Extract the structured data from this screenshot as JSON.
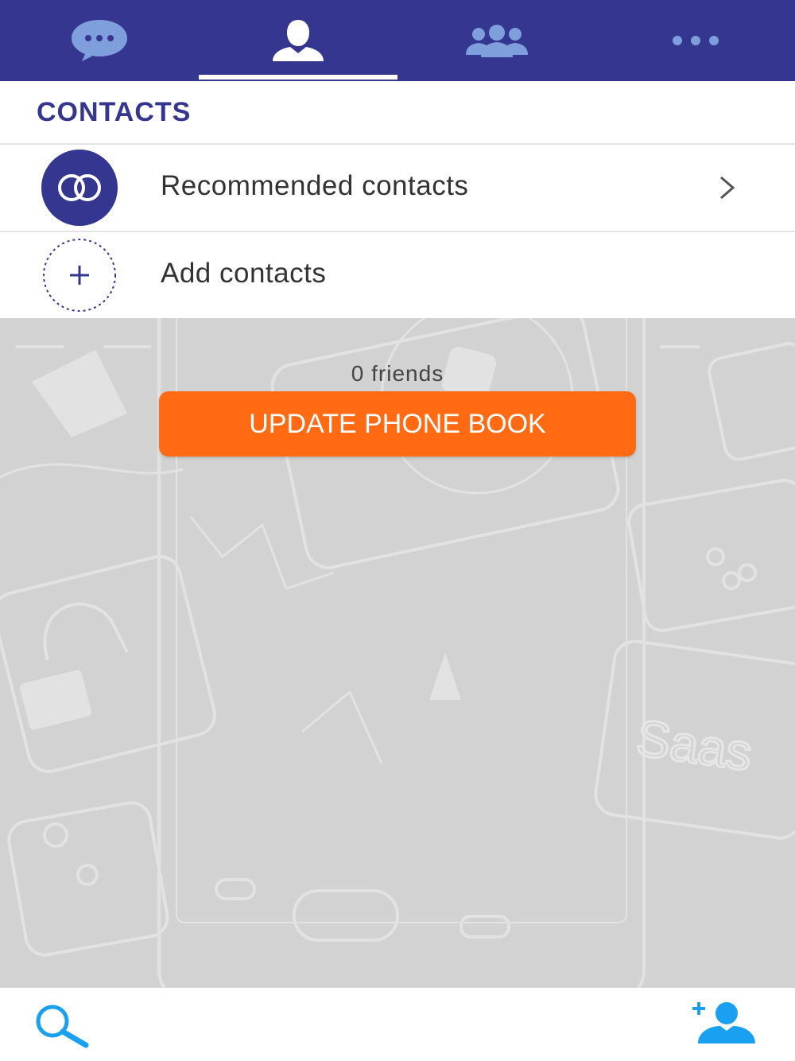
{
  "tabs": [
    {
      "name": "chats",
      "icon": "chat-bubble-icon",
      "active": false
    },
    {
      "name": "contacts",
      "icon": "person-icon",
      "active": true
    },
    {
      "name": "groups",
      "icon": "group-icon",
      "active": false
    },
    {
      "name": "more",
      "icon": "more-dots-icon",
      "active": false
    }
  ],
  "section": {
    "title": "CONTACTS"
  },
  "rows": {
    "recommended": {
      "label": "Recommended contacts",
      "icon": "linked-rings-icon"
    },
    "add": {
      "label": "Add contacts",
      "icon": "plus-circle-icon"
    }
  },
  "phonebook": {
    "friends_count": "0 friends",
    "update_button": "UPDATE PHONE BOOK"
  },
  "bottom_bar": {
    "search_icon": "search-icon",
    "add_contact_icon": "add-contact-icon"
  },
  "colors": {
    "header": "#35368f",
    "accent_orange": "#ff6a13",
    "icon_blue": "#1aa0f0",
    "inactive_tab_icon": "#7f9fdc"
  }
}
